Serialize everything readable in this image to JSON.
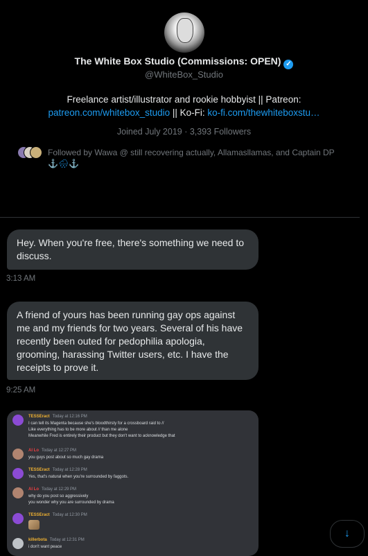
{
  "profile": {
    "name": "The White Box Studio (Commissions: OPEN)",
    "handle": "@WhiteBox_Studio",
    "bio_line1": "Freelance artist/illustrator and rookie hobbyist || Patreon:",
    "bio_link1": "patreon.com/whitebox_studio",
    "bio_sep": " || Ko-Fi: ",
    "bio_link2": "ko-fi.com/thewhiteboxstu…",
    "joined": "Joined July 2019",
    "dot": " · ",
    "followers": "3,393 Followers",
    "followed_by": "Followed by Wawa @ still recovering actually, Allamasllamas, and Captain DP",
    "followed_emoji": "⚓🌧⚓"
  },
  "messages": [
    {
      "text": "Hey. When you're free, there's something we need to discuss.",
      "time": "3:13 AM"
    },
    {
      "text": "A friend of yours has been running gay ops against me and my friends for two years. Several of his have recently been outed for pedophilia apologia, grooming, harassing Twitter users, etc. I have the receipts to prove it.",
      "time": "9:25 AM"
    }
  ],
  "screenshot": {
    "entries": [
      {
        "name": "TESSEract",
        "time": "Today at 12:16 PM",
        "lines": [
          "I can tell its Magenta because she's bloodthirsty for a crossboard raid to //",
          "Like everything has to be more about // than me alone",
          "Meanwhile Fred is entirely their product but they don't want to acknowledge that"
        ]
      },
      {
        "name": "Al Lo",
        "time": "Today at 12:27 PM",
        "lines": [
          "you guys post about so much gay drama"
        ]
      },
      {
        "name": "TESSEract",
        "time": "Today at 12:28 PM",
        "lines": [
          "Yes, that's natural when you're surrounded by faggots."
        ]
      },
      {
        "name": "Al Lo",
        "time": "Today at 12:29 PM",
        "lines": [
          "why do you post so aggressively",
          "you wonder why you are surrounded by drama"
        ]
      },
      {
        "name": "TESSEract",
        "time": "Today at 12:30 PM",
        "lines": []
      },
      {
        "name": "killerbota",
        "time": "Today at 12:31 PM",
        "lines": [
          "i don't want peace"
        ]
      }
    ]
  },
  "colors": {
    "accent": "#1d9bf0",
    "bubble": "#2f3336",
    "muted": "#71767b"
  },
  "icons": {
    "verified": "verified-badge-icon",
    "scroll": "arrow-down-icon"
  }
}
